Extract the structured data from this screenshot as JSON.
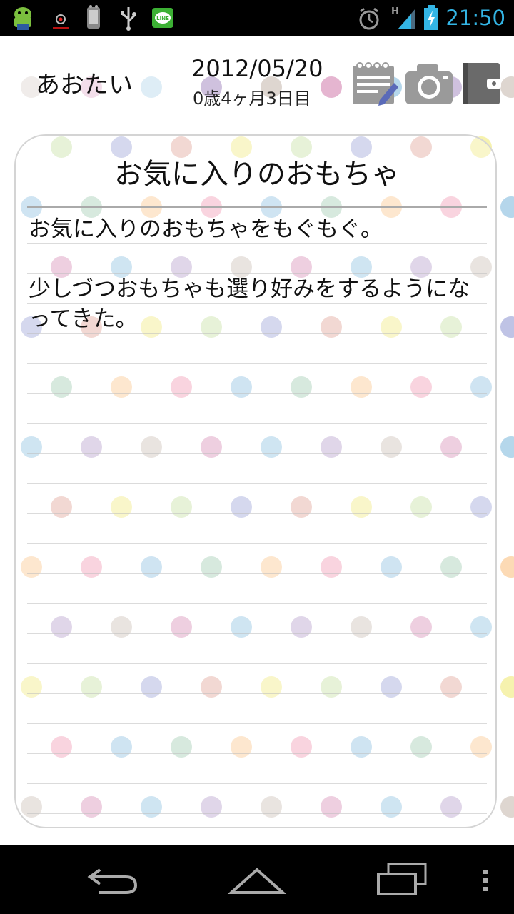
{
  "status_bar": {
    "time": "21:50",
    "time_color": "#33b5e5",
    "network_label": "H",
    "icons": [
      "android-mascot-icon",
      "eye-app-icon",
      "debug-phone-icon",
      "usb-icon",
      "line-app-icon",
      "alarm-icon",
      "signal-icon",
      "battery-charging-icon"
    ]
  },
  "header": {
    "child_name": "あおたい",
    "date": "2012/05/20",
    "age": "0歳4ヶ月3日目",
    "buttons": [
      "diary-edit-icon",
      "camera-icon",
      "album-icon"
    ]
  },
  "note": {
    "title": "お気に入りのおもちゃ",
    "body": "お気に入りのおもちゃをもぐもぐ。\n\n少しづつおもちゃも選り好みをするようになってきた。"
  },
  "nav_bar": {
    "buttons": [
      "back-icon",
      "home-icon",
      "recent-apps-icon",
      "menu-icon"
    ]
  },
  "colors": {
    "dots": [
      "#d8cfc8",
      "#b7d8c4",
      "#f4f0a0",
      "#e0a8c8",
      "#fcd3a8",
      "#d3e8b8",
      "#a8d0e8",
      "#f5b3c6",
      "#b4b8e0",
      "#c7b6d8",
      "#a8cfe8",
      "#e8b8b0"
    ]
  }
}
